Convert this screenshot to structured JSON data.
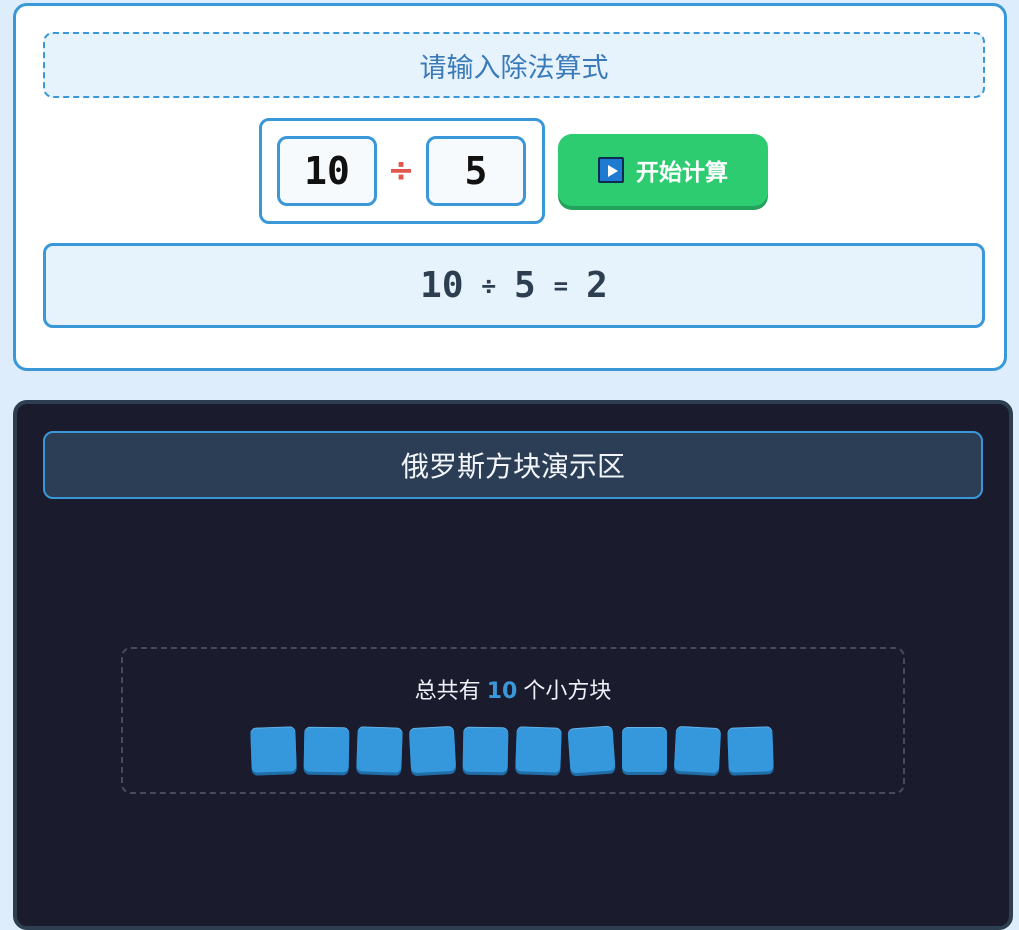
{
  "input_card": {
    "prompt": "请输入除法算式",
    "dividend": "10",
    "operator": "÷",
    "divisor": "5",
    "start_button_label": "开始计算"
  },
  "result": {
    "dividend": "10",
    "operator": "÷",
    "divisor": "5",
    "equals": "=",
    "quotient": "2"
  },
  "demo": {
    "title": "俄罗斯方块演示区",
    "count_prefix": "总共有",
    "count_value": "10",
    "count_suffix": "个小方块",
    "block_count": 10,
    "block_color": "#3598dc"
  },
  "colors": {
    "accent": "#3a98d8",
    "button": "#2ecc71",
    "operator": "#e2574c",
    "demo_bg": "#1b1b2e"
  }
}
